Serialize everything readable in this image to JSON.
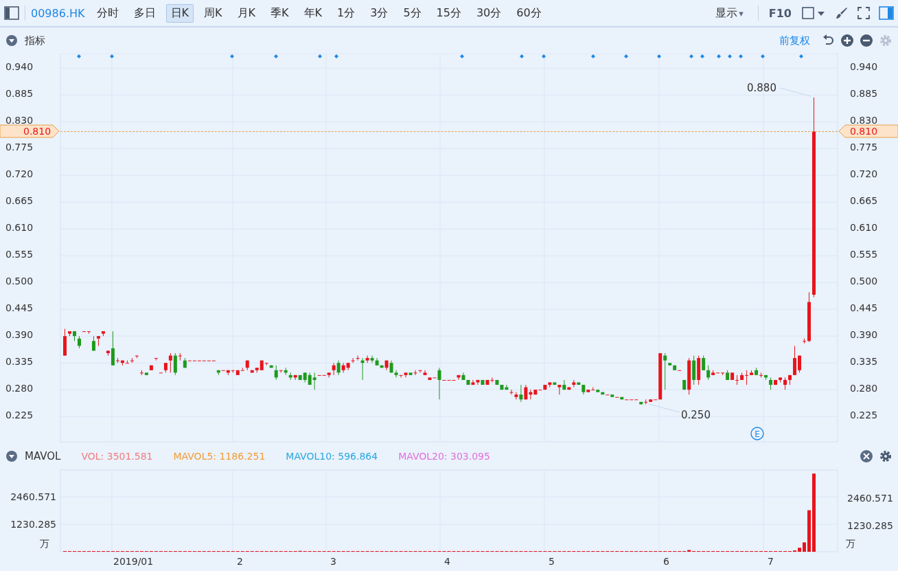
{
  "toolbar": {
    "symbol": "00986.HK",
    "periods": [
      {
        "label": "分时",
        "selected": false
      },
      {
        "label": "多日",
        "selected": false
      },
      {
        "label": "日K",
        "selected": true
      },
      {
        "label": "周K",
        "selected": false
      },
      {
        "label": "月K",
        "selected": false
      },
      {
        "label": "季K",
        "selected": false
      },
      {
        "label": "年K",
        "selected": false
      },
      {
        "label": "1分",
        "selected": false
      },
      {
        "label": "3分",
        "selected": false
      },
      {
        "label": "5分",
        "selected": false
      },
      {
        "label": "15分",
        "selected": false
      },
      {
        "label": "30分",
        "selected": false
      },
      {
        "label": "60分",
        "selected": false
      }
    ],
    "display": "显示",
    "display_caret": "▾",
    "f10": "F10"
  },
  "indicator_panel": {
    "title": "指标",
    "adjust": "前复权",
    "right_axis_labels": [
      "0.940",
      "0.885",
      "0.830",
      "0.775",
      "0.720",
      "0.665",
      "0.610",
      "0.555",
      "0.500",
      "0.445",
      "0.390",
      "0.335",
      "0.280",
      "0.225"
    ],
    "price_tags": [
      "0.810",
      "0.810"
    ],
    "high_label": "0.880",
    "low_label": "0.250",
    "event_mark": "E",
    "chart_data": {
      "type": "candlestick",
      "grid": true,
      "ylim": [
        0.173,
        0.97
      ],
      "yticks": [
        {
          "value": 0.94,
          "label": "0.940"
        },
        {
          "value": 0.885,
          "label": "0.885"
        },
        {
          "value": 0.83,
          "label": "0.830"
        },
        {
          "value": 0.775,
          "label": "0.775"
        },
        {
          "value": 0.72,
          "label": "0.720"
        },
        {
          "value": 0.665,
          "label": "0.665"
        },
        {
          "value": 0.61,
          "label": "0.610"
        },
        {
          "value": 0.555,
          "label": "0.555"
        },
        {
          "value": 0.5,
          "label": "0.500"
        },
        {
          "value": 0.445,
          "label": "0.445"
        },
        {
          "value": 0.39,
          "label": "0.390"
        },
        {
          "value": 0.335,
          "label": "0.335"
        },
        {
          "value": 0.28,
          "label": "0.280"
        },
        {
          "value": 0.225,
          "label": "0.225"
        }
      ],
      "ohlc": [
        [
          0.35,
          0.405,
          0.35,
          0.39
        ],
        [
          0.395,
          0.4,
          0.39,
          0.4
        ],
        [
          0.4,
          0.4,
          0.38,
          0.39
        ],
        [
          0.385,
          0.39,
          0.365,
          0.37
        ],
        [
          0.4,
          0.4,
          0.4,
          0.4
        ],
        [
          0.4,
          0.4,
          0.395,
          0.4
        ],
        [
          0.38,
          0.39,
          0.36,
          0.36
        ],
        [
          0.385,
          0.39,
          0.37,
          0.39
        ],
        [
          0.395,
          0.4,
          0.39,
          0.4
        ],
        [
          0.355,
          0.36,
          0.35,
          0.36
        ],
        [
          0.365,
          0.4,
          0.33,
          0.33
        ],
        [
          0.34,
          0.345,
          0.335,
          0.34
        ],
        [
          0.335,
          0.34,
          0.33,
          0.34
        ],
        [
          0.335,
          0.34,
          0.335,
          0.335
        ],
        [
          0.34,
          0.345,
          0.335,
          0.34
        ],
        [
          0.35,
          0.35,
          0.345,
          0.35
        ],
        [
          0.315,
          0.32,
          0.31,
          0.315
        ],
        [
          0.315,
          0.315,
          0.31,
          0.31
        ],
        [
          0.32,
          0.33,
          0.32,
          0.33
        ],
        [
          0.345,
          0.345,
          0.34,
          0.345
        ],
        [
          0.315,
          0.315,
          0.315,
          0.315
        ],
        [
          0.32,
          0.335,
          0.315,
          0.335
        ],
        [
          0.34,
          0.355,
          0.315,
          0.35
        ],
        [
          0.35,
          0.355,
          0.31,
          0.315
        ],
        [
          0.35,
          0.355,
          0.34,
          0.35
        ],
        [
          0.34,
          0.345,
          0.325,
          0.325
        ],
        [
          0.34,
          0.34,
          0.34,
          0.34
        ],
        [
          0.34,
          0.34,
          0.34,
          0.34
        ],
        [
          0.34,
          0.34,
          0.34,
          0.34
        ],
        [
          0.34,
          0.34,
          0.34,
          0.34
        ],
        [
          0.34,
          0.34,
          0.34,
          0.34
        ],
        [
          0.34,
          0.34,
          0.34,
          0.34
        ],
        [
          0.32,
          0.32,
          0.31,
          0.315
        ],
        [
          0.32,
          0.32,
          0.32,
          0.32
        ],
        [
          0.315,
          0.32,
          0.31,
          0.32
        ],
        [
          0.32,
          0.32,
          0.315,
          0.32
        ],
        [
          0.31,
          0.32,
          0.31,
          0.32
        ],
        [
          0.32,
          0.325,
          0.32,
          0.32
        ],
        [
          0.325,
          0.34,
          0.32,
          0.34
        ],
        [
          0.315,
          0.32,
          0.315,
          0.32
        ],
        [
          0.32,
          0.325,
          0.315,
          0.325
        ],
        [
          0.32,
          0.34,
          0.32,
          0.34
        ],
        [
          0.335,
          0.335,
          0.33,
          0.335
        ],
        [
          0.33,
          0.33,
          0.325,
          0.325
        ],
        [
          0.32,
          0.33,
          0.3,
          0.305
        ],
        [
          0.32,
          0.32,
          0.315,
          0.32
        ],
        [
          0.32,
          0.325,
          0.31,
          0.315
        ],
        [
          0.31,
          0.315,
          0.3,
          0.305
        ],
        [
          0.305,
          0.31,
          0.3,
          0.31
        ],
        [
          0.31,
          0.31,
          0.3,
          0.3
        ],
        [
          0.315,
          0.315,
          0.295,
          0.3
        ],
        [
          0.31,
          0.315,
          0.29,
          0.29
        ],
        [
          0.305,
          0.315,
          0.28,
          0.3
        ],
        [
          0.31,
          0.31,
          0.31,
          0.31
        ],
        [
          0.31,
          0.31,
          0.31,
          0.31
        ],
        [
          0.31,
          0.315,
          0.305,
          0.315
        ],
        [
          0.32,
          0.335,
          0.31,
          0.33
        ],
        [
          0.335,
          0.34,
          0.31,
          0.315
        ],
        [
          0.32,
          0.335,
          0.315,
          0.33
        ],
        [
          0.325,
          0.335,
          0.32,
          0.335
        ],
        [
          0.34,
          0.345,
          0.335,
          0.34
        ],
        [
          0.345,
          0.35,
          0.34,
          0.345
        ],
        [
          0.34,
          0.345,
          0.3,
          0.335
        ],
        [
          0.34,
          0.35,
          0.335,
          0.345
        ],
        [
          0.345,
          0.35,
          0.335,
          0.34
        ],
        [
          0.34,
          0.345,
          0.33,
          0.33
        ],
        [
          0.33,
          0.33,
          0.325,
          0.325
        ],
        [
          0.325,
          0.34,
          0.32,
          0.34
        ],
        [
          0.335,
          0.34,
          0.315,
          0.315
        ],
        [
          0.315,
          0.32,
          0.305,
          0.31
        ],
        [
          0.31,
          0.31,
          0.305,
          0.31
        ],
        [
          0.31,
          0.315,
          0.305,
          0.315
        ],
        [
          0.315,
          0.315,
          0.31,
          0.31
        ],
        [
          0.315,
          0.32,
          0.31,
          0.315
        ],
        [
          0.32,
          0.32,
          0.315,
          0.32
        ],
        [
          0.31,
          0.32,
          0.31,
          0.315
        ],
        [
          0.3,
          0.305,
          0.3,
          0.305
        ],
        [
          0.305,
          0.305,
          0.305,
          0.305
        ],
        [
          0.32,
          0.325,
          0.26,
          0.3
        ],
        [
          0.3,
          0.3,
          0.3,
          0.3
        ],
        [
          0.3,
          0.3,
          0.3,
          0.3
        ],
        [
          0.3,
          0.3,
          0.3,
          0.3
        ],
        [
          0.305,
          0.31,
          0.3,
          0.31
        ],
        [
          0.31,
          0.315,
          0.3,
          0.3
        ],
        [
          0.3,
          0.3,
          0.29,
          0.29
        ],
        [
          0.29,
          0.3,
          0.29,
          0.295
        ],
        [
          0.295,
          0.3,
          0.29,
          0.3
        ],
        [
          0.3,
          0.3,
          0.29,
          0.29
        ],
        [
          0.29,
          0.3,
          0.29,
          0.3
        ],
        [
          0.3,
          0.305,
          0.295,
          0.3
        ],
        [
          0.3,
          0.3,
          0.29,
          0.29
        ],
        [
          0.29,
          0.29,
          0.28,
          0.28
        ],
        [
          0.285,
          0.29,
          0.28,
          0.28
        ],
        [
          0.275,
          0.28,
          0.27,
          0.275
        ],
        [
          0.265,
          0.275,
          0.26,
          0.27
        ],
        [
          0.27,
          0.29,
          0.255,
          0.26
        ],
        [
          0.26,
          0.29,
          0.26,
          0.285
        ],
        [
          0.27,
          0.28,
          0.26,
          0.275
        ],
        [
          0.27,
          0.28,
          0.27,
          0.28
        ],
        [
          0.28,
          0.28,
          0.28,
          0.28
        ],
        [
          0.28,
          0.29,
          0.28,
          0.29
        ],
        [
          0.29,
          0.295,
          0.285,
          0.295
        ],
        [
          0.295,
          0.295,
          0.29,
          0.29
        ],
        [
          0.285,
          0.29,
          0.27,
          0.29
        ],
        [
          0.29,
          0.3,
          0.28,
          0.28
        ],
        [
          0.28,
          0.285,
          0.28,
          0.285
        ],
        [
          0.29,
          0.3,
          0.285,
          0.295
        ],
        [
          0.295,
          0.295,
          0.29,
          0.29
        ],
        [
          0.29,
          0.29,
          0.27,
          0.275
        ],
        [
          0.275,
          0.28,
          0.275,
          0.28
        ],
        [
          0.28,
          0.285,
          0.28,
          0.28
        ],
        [
          0.28,
          0.28,
          0.275,
          0.275
        ],
        [
          0.275,
          0.275,
          0.27,
          0.27
        ],
        [
          0.27,
          0.27,
          0.27,
          0.27
        ],
        [
          0.27,
          0.27,
          0.265,
          0.265
        ],
        [
          0.265,
          0.265,
          0.265,
          0.265
        ],
        [
          0.265,
          0.265,
          0.26,
          0.26
        ],
        [
          0.26,
          0.26,
          0.26,
          0.26
        ],
        [
          0.26,
          0.26,
          0.26,
          0.26
        ],
        [
          0.26,
          0.26,
          0.26,
          0.26
        ],
        [
          0.255,
          0.255,
          0.25,
          0.25
        ],
        [
          0.255,
          0.26,
          0.25,
          0.255
        ],
        [
          0.255,
          0.26,
          0.255,
          0.26
        ],
        [
          0.26,
          0.26,
          0.26,
          0.26
        ],
        [
          0.26,
          0.355,
          0.26,
          0.355
        ],
        [
          0.35,
          0.355,
          0.28,
          0.34
        ],
        [
          0.335,
          0.335,
          0.33,
          0.33
        ],
        [
          0.33,
          0.33,
          0.32,
          0.32
        ],
        [
          0.32,
          0.32,
          0.32,
          0.32
        ],
        [
          0.3,
          0.3,
          0.28,
          0.28
        ],
        [
          0.28,
          0.345,
          0.27,
          0.34
        ],
        [
          0.34,
          0.35,
          0.29,
          0.3
        ],
        [
          0.3,
          0.35,
          0.29,
          0.345
        ],
        [
          0.345,
          0.35,
          0.32,
          0.32
        ],
        [
          0.32,
          0.33,
          0.3,
          0.305
        ],
        [
          0.31,
          0.32,
          0.31,
          0.315
        ],
        [
          0.315,
          0.315,
          0.315,
          0.315
        ],
        [
          0.315,
          0.315,
          0.31,
          0.315
        ],
        [
          0.315,
          0.32,
          0.3,
          0.3
        ],
        [
          0.3,
          0.315,
          0.3,
          0.315
        ],
        [
          0.3,
          0.31,
          0.29,
          0.3
        ],
        [
          0.3,
          0.315,
          0.3,
          0.31
        ],
        [
          0.31,
          0.32,
          0.29,
          0.31
        ],
        [
          0.31,
          0.32,
          0.31,
          0.315
        ],
        [
          0.32,
          0.325,
          0.31,
          0.31
        ],
        [
          0.31,
          0.315,
          0.305,
          0.31
        ],
        [
          0.31,
          0.31,
          0.3,
          0.305
        ],
        [
          0.3,
          0.305,
          0.28,
          0.29
        ],
        [
          0.29,
          0.3,
          0.29,
          0.3
        ],
        [
          0.3,
          0.305,
          0.295,
          0.305
        ],
        [
          0.29,
          0.305,
          0.28,
          0.3
        ],
        [
          0.3,
          0.31,
          0.29,
          0.31
        ],
        [
          0.31,
          0.37,
          0.31,
          0.345
        ],
        [
          0.32,
          0.35,
          0.315,
          0.35
        ],
        [
          0.38,
          0.385,
          0.375,
          0.38
        ],
        [
          0.38,
          0.48,
          0.378,
          0.46
        ],
        [
          0.475,
          0.88,
          0.47,
          0.81
        ]
      ]
    }
  },
  "volume_panel": {
    "title": "MAVOL",
    "legend": [
      {
        "name": "VOL:",
        "value": "3501.581",
        "color": "#f07c7c"
      },
      {
        "name": "MAVOL5:",
        "value": "1186.251",
        "color": "#f39c33"
      },
      {
        "name": "MAVOL10:",
        "value": "596.864",
        "color": "#27a7e0"
      },
      {
        "name": "MAVOL20:",
        "value": "303.095",
        "color": "#e070d8"
      }
    ],
    "right_axis_labels": [
      "2460.571",
      "1230.285"
    ],
    "units": [
      "万",
      "万"
    ],
    "chart_data": {
      "type": "bar",
      "grid": true,
      "ylim": [
        0,
        3660
      ],
      "yticks": [
        {
          "value": 2460.571,
          "label": "2460.571"
        },
        {
          "value": 1230.285,
          "label": "1230.285"
        }
      ],
      "series": [
        {
          "color": "#e8141c",
          "values": [
            0,
            0,
            0,
            0,
            0,
            0,
            0,
            0,
            0,
            0,
            0,
            0,
            0,
            0,
            0,
            0,
            0,
            0,
            0,
            0,
            0,
            0,
            0,
            0,
            0,
            0,
            0,
            0,
            0,
            0,
            0,
            0,
            0,
            0,
            0,
            0,
            0,
            0,
            0,
            0,
            0,
            0,
            0,
            0,
            0,
            0,
            0,
            0,
            0,
            40,
            0,
            0,
            0,
            0,
            0,
            0,
            0,
            0,
            0,
            0,
            0,
            0,
            0,
            0,
            0,
            0,
            0,
            0,
            0,
            0,
            0,
            0,
            0,
            0,
            0,
            0,
            0,
            0,
            0,
            0,
            0,
            0,
            0,
            0,
            0,
            0,
            0,
            0,
            0,
            0,
            0,
            0,
            0,
            0,
            0,
            0,
            0,
            0,
            0,
            0,
            0,
            0,
            0,
            0,
            0,
            0,
            0,
            0,
            0,
            0,
            0,
            0,
            0,
            0,
            0,
            0,
            0,
            0,
            0,
            0,
            0,
            0,
            0,
            0,
            0,
            0,
            0,
            30,
            0,
            0,
            80,
            0,
            0,
            0,
            0,
            0,
            0,
            0,
            0,
            0,
            0,
            0,
            0,
            0,
            0,
            0,
            0,
            0,
            0,
            0,
            30,
            20,
            60,
            180,
            420,
            1860,
            3500
          ]
        }
      ]
    }
  },
  "x_labels": [
    "2019/01",
    "2",
    "3",
    "4",
    "5",
    "6",
    "7"
  ]
}
